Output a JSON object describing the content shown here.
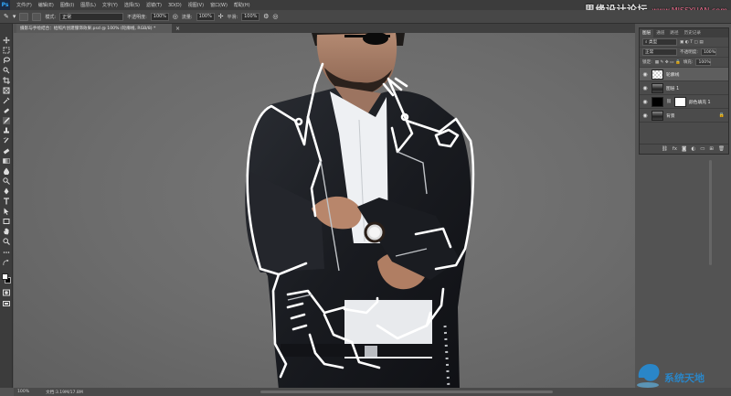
{
  "app": {
    "logo": "Ps",
    "menu": [
      "文件(F)",
      "编辑(E)",
      "图像(I)",
      "图层(L)",
      "文字(Y)",
      "选择(S)",
      "滤镜(T)",
      "3D(D)",
      "视图(V)",
      "窗口(W)",
      "帮助(H)"
    ],
    "site_mark": "思缘设计论坛",
    "site_url": "www.MISSYUAN.com"
  },
  "options": {
    "mode_label": "模式:",
    "mode_value": "正常",
    "opacity_label": "不透明度:",
    "opacity_value": "100%",
    "flow_label": "流量:",
    "flow_value": "100%",
    "smooth_label": "平滑:",
    "smooth_value": "100%"
  },
  "document": {
    "tab_title": "摄影与手绘结合：给照片创建服饰效果.psd @ 100% (轮廓线, RGB/8) *",
    "zoom": "100%",
    "doc_info": "文档:3.19M/17.8M"
  },
  "layers_panel": {
    "tabs": [
      "图层",
      "通道",
      "路径",
      "历史记录"
    ],
    "kind_label": "类型",
    "blend_mode": "正常",
    "opacity_label": "不透明度:",
    "opacity": "100%",
    "lock_label": "锁定:",
    "fill_label": "填充:",
    "fill": "100%",
    "layers": [
      {
        "name": "轮廓线",
        "thumb": "checker"
      },
      {
        "name": "图层 1",
        "thumb": "photo"
      },
      {
        "name": "颜色填充 1",
        "thumb": "black"
      },
      {
        "name": "背景",
        "thumb": "photo"
      }
    ],
    "footer_icons": [
      "link-icon",
      "fx-icon",
      "mask-icon",
      "adjustment-icon",
      "group-icon",
      "new-layer-icon",
      "trash-icon"
    ]
  },
  "watermark": {
    "text": "系统天地"
  },
  "colors": {
    "accent": "#31a8ff",
    "line_art": "#ffffff",
    "watermark": "#2a86c8"
  }
}
